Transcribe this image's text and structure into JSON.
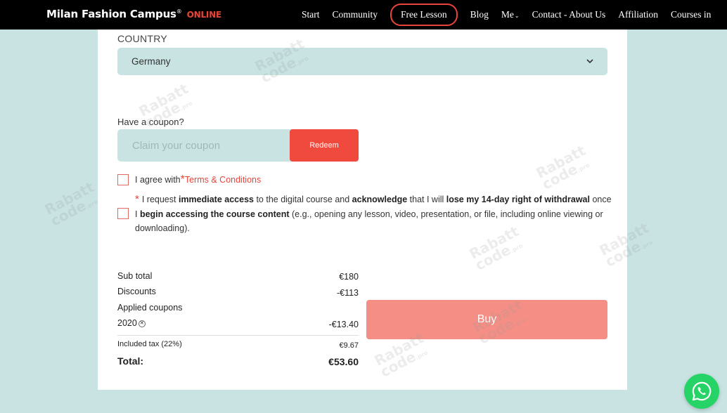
{
  "header": {
    "logo": "Milan Fashion Campus",
    "logo_reg": "®",
    "logo_suffix": "ONLINE",
    "nav": {
      "start": "Start",
      "community": "Community",
      "free_lesson": "Free Lesson",
      "blog": "Blog",
      "me": "Me",
      "contact": "Contact - About Us",
      "affiliation": "Affiliation",
      "courses": "Courses in"
    }
  },
  "country": {
    "label": "COUNTRY",
    "selected": "Germany"
  },
  "coupon": {
    "label": "Have a coupon?",
    "placeholder": "Claim your coupon",
    "redeem_label": "Redeem"
  },
  "consent": {
    "agree_prefix": "I agree with",
    "star": "*",
    "terms_link": "Terms & Conditions",
    "withdraw_t1": "I request ",
    "withdraw_b1": "immediate access",
    "withdraw_t2": " to the digital course and ",
    "withdraw_b2": "acknowledge",
    "withdraw_t3": " that I will ",
    "withdraw_b3": "lose my 14-day right of withdrawal",
    "withdraw_t4": " once I ",
    "withdraw_b4": "begin accessing the course content",
    "withdraw_t5": " (e.g., opening any lesson, video, presentation, or file, including online viewing or downloading)."
  },
  "summary": {
    "subtotal_label": "Sub total",
    "subtotal_value": "€180",
    "discounts_label": "Discounts",
    "discounts_value": "-€113",
    "applied_label": "Applied coupons",
    "coupon_code": "2020",
    "coupon_value": "-€13.40",
    "tax_label": "Included tax",
    "tax_rate": "(22%)",
    "tax_value": "€9.67",
    "total_label": "Total:",
    "total_value": "€53.60"
  },
  "buy_label": "Buy",
  "watermark": {
    "line1": "Rabatt",
    "line2": "code",
    "suffix": ".pro"
  },
  "colors": {
    "accent": "#f04a3e",
    "buy_button": "#f58f86",
    "field_bg": "#c9e3e3",
    "whatsapp": "#25d366"
  },
  "icons": [
    "chevron-down-icon",
    "close-circle-icon",
    "whatsapp-icon"
  ]
}
